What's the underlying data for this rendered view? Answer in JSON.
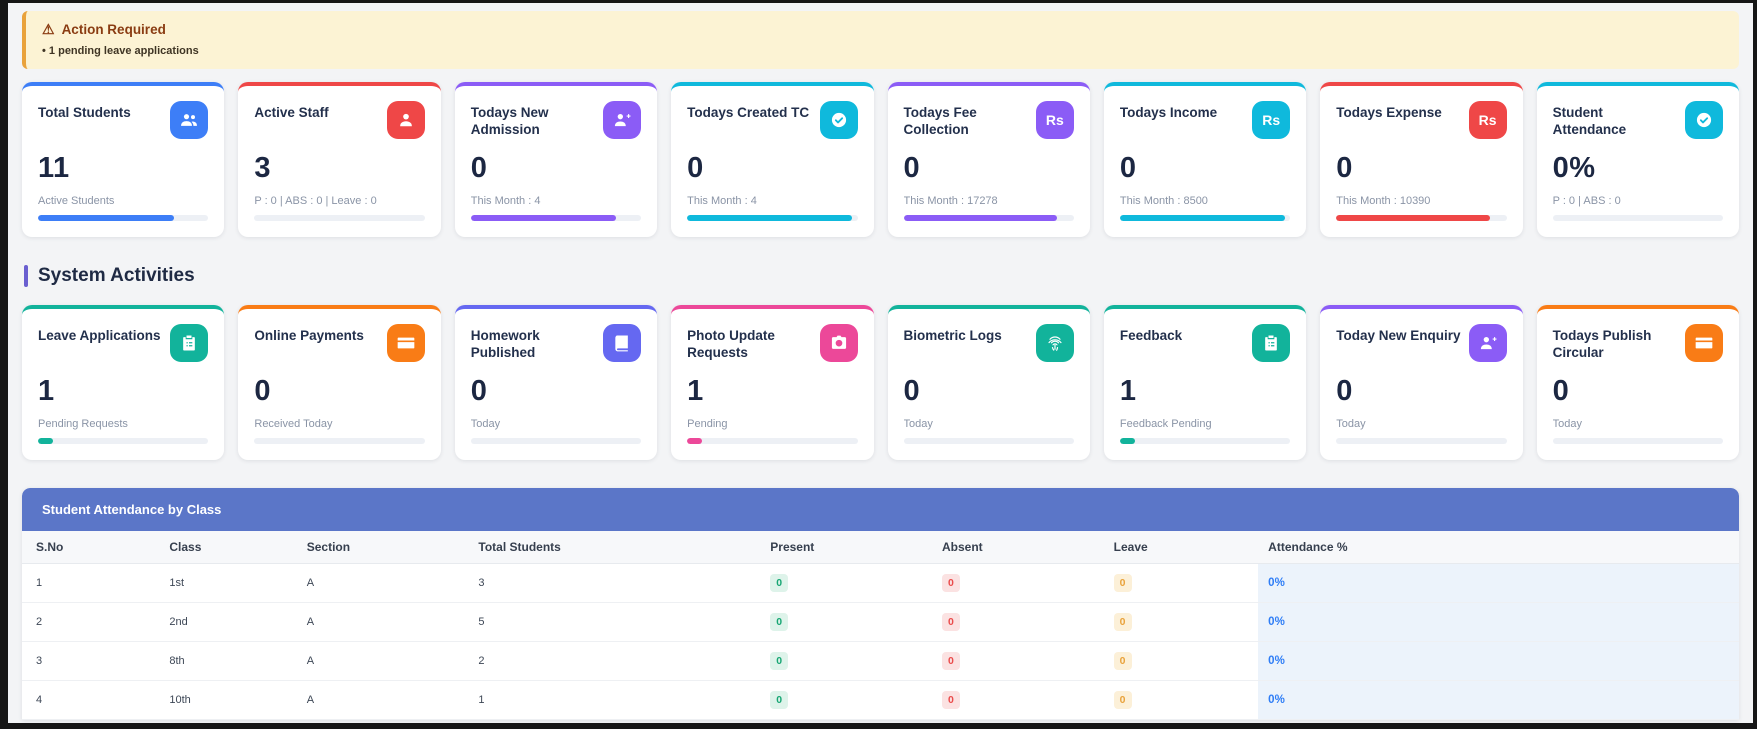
{
  "alert": {
    "title": "Action Required",
    "warning_icon": "warning-triangle-icon",
    "items": [
      "1 pending leave applications"
    ]
  },
  "section": {
    "title": "System Activities"
  },
  "colors": {
    "blue": "#3d7ef7",
    "red": "#ef4747",
    "purple": "#8b5cf6",
    "cyan": "#0fb9dc",
    "teal": "#12b39b",
    "orange": "#f97c16",
    "indigo": "#6568f1",
    "pink": "#ec4899",
    "banner_blue": "#5b76c8",
    "attendance_col_bg": "#ecf3fb",
    "attendance_text": "#2e7df6"
  },
  "stats_cards": [
    {
      "title": "Total Students",
      "icon": "users-icon",
      "color": "#3d7ef7",
      "value": "11",
      "subtitle": "Active Students",
      "progress": 80
    },
    {
      "title": "Active Staff",
      "icon": "user-icon",
      "color": "#ef4747",
      "value": "3",
      "subtitle": "P : 0 | ABS : 0 | Leave : 0",
      "progress": 0
    },
    {
      "title": "Todays New Admission",
      "icon": "user-plus-icon",
      "color": "#8b5cf6",
      "value": "0",
      "subtitle": "This Month : 4",
      "progress": 85
    },
    {
      "title": "Todays Created TC",
      "icon": "check-circle-icon",
      "color": "#0fb9dc",
      "value": "0",
      "subtitle": "This Month : 4",
      "progress": 97
    },
    {
      "title": "Todays Fee Collection",
      "icon": "rupee-icon",
      "color": "#8b5cf6",
      "value": "0",
      "subtitle": "This Month : 17278",
      "progress": 90
    },
    {
      "title": "Todays Income",
      "icon": "rupee-icon",
      "color": "#0fb9dc",
      "value": "0",
      "subtitle": "This Month : 8500",
      "progress": 97
    },
    {
      "title": "Todays Expense",
      "icon": "rupee-icon",
      "color": "#ef4747",
      "value": "0",
      "subtitle": "This Month : 10390",
      "progress": 90
    },
    {
      "title": "Student Attendance",
      "icon": "check-circle-icon",
      "color": "#0fb9dc",
      "value": "0%",
      "subtitle": "P : 0 | ABS : 0",
      "progress": 0
    }
  ],
  "activity_cards": [
    {
      "title": "Leave Applications",
      "icon": "clipboard-icon",
      "color": "#12b39b",
      "value": "1",
      "subtitle": "Pending Requests",
      "progress": 9
    },
    {
      "title": "Online Payments",
      "icon": "credit-card-icon",
      "color": "#f97c16",
      "value": "0",
      "subtitle": "Received Today",
      "progress": 0
    },
    {
      "title": "Homework Published",
      "icon": "book-icon",
      "color": "#6568f1",
      "value": "0",
      "subtitle": "Today",
      "progress": 0
    },
    {
      "title": "Photo Update Requests",
      "icon": "camera-icon",
      "color": "#ec4899",
      "value": "1",
      "subtitle": "Pending",
      "progress": 9
    },
    {
      "title": "Biometric Logs",
      "icon": "fingerprint-icon",
      "color": "#12b39b",
      "value": "0",
      "subtitle": "Today",
      "progress": 0
    },
    {
      "title": "Feedback",
      "icon": "clipboard-icon",
      "color": "#12b39b",
      "value": "1",
      "subtitle": "Feedback Pending",
      "progress": 9
    },
    {
      "title": "Today New Enquiry",
      "icon": "user-plus-icon",
      "color": "#8b5cf6",
      "value": "0",
      "subtitle": "Today",
      "progress": 0
    },
    {
      "title": "Todays Publish Circular",
      "icon": "credit-card-icon",
      "color": "#f97c16",
      "value": "0",
      "subtitle": "Today",
      "progress": 0
    }
  ],
  "table": {
    "title": "Student Attendance by Class",
    "columns": [
      "S.No",
      "Class",
      "Section",
      "Total Students",
      "Present",
      "Absent",
      "Leave",
      "Attendance %"
    ],
    "rows": [
      {
        "sno": "1",
        "class": "1st",
        "section": "A",
        "total": "3",
        "present": "0",
        "absent": "0",
        "leave": "0",
        "attendance": "0%"
      },
      {
        "sno": "2",
        "class": "2nd",
        "section": "A",
        "total": "5",
        "present": "0",
        "absent": "0",
        "leave": "0",
        "attendance": "0%"
      },
      {
        "sno": "3",
        "class": "8th",
        "section": "A",
        "total": "2",
        "present": "0",
        "absent": "0",
        "leave": "0",
        "attendance": "0%"
      },
      {
        "sno": "4",
        "class": "10th",
        "section": "A",
        "total": "1",
        "present": "0",
        "absent": "0",
        "leave": "0",
        "attendance": "0%"
      }
    ]
  }
}
